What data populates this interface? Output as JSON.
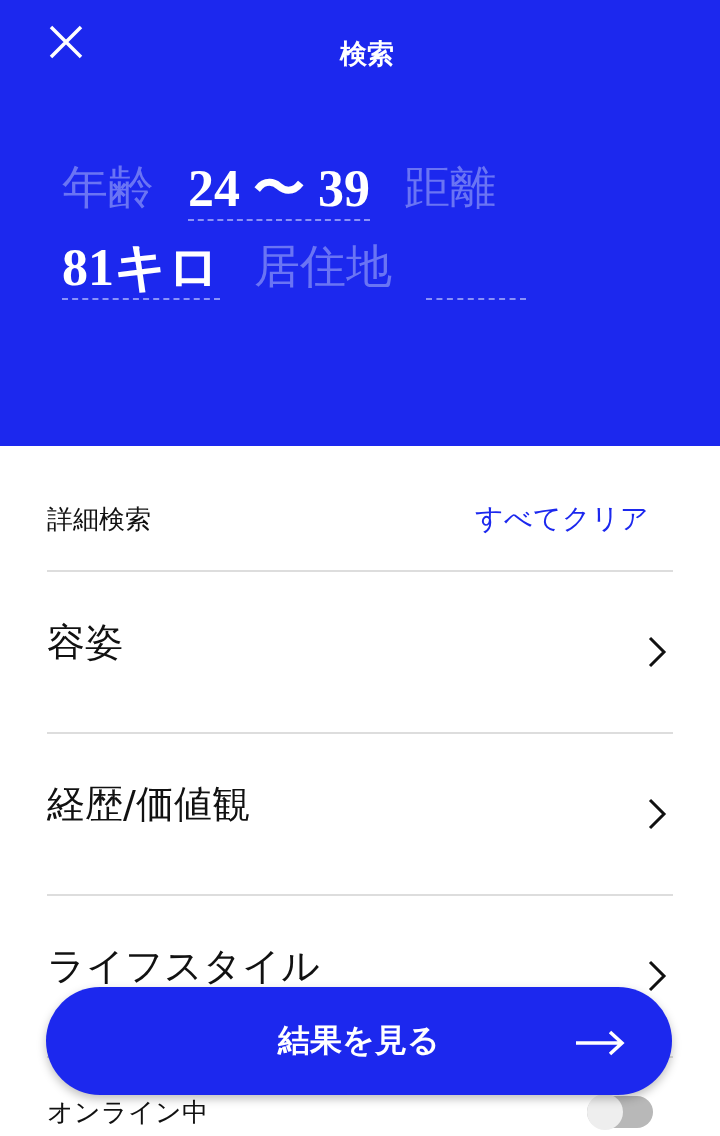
{
  "header": {
    "title": "検索"
  },
  "query": [
    {
      "kind": "label",
      "text": "年齢"
    },
    {
      "kind": "value",
      "text": "24 〜 39"
    },
    {
      "kind": "label",
      "text": "距離"
    },
    {
      "kind": "value",
      "text": "81キロ"
    },
    {
      "kind": "label",
      "text": "居住地"
    },
    {
      "kind": "empty"
    }
  ],
  "details": {
    "title": "詳細検索",
    "clear": "すべてクリア"
  },
  "categories": [
    {
      "label": "容姿"
    },
    {
      "label": "経歴/価値観"
    },
    {
      "label": "ライフスタイル"
    }
  ],
  "online": {
    "label": "オンライン中",
    "on": false
  },
  "results_button": {
    "label": "結果を見る"
  }
}
